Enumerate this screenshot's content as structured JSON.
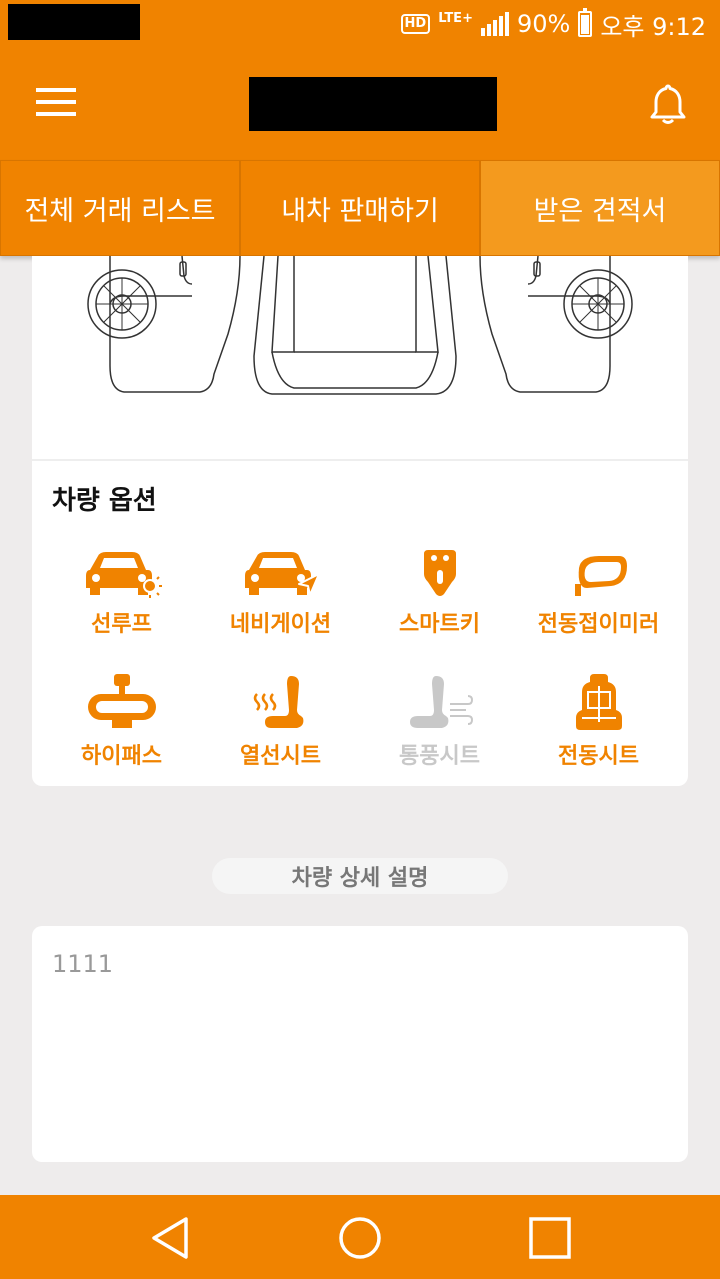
{
  "status_bar": {
    "hd": "HD",
    "network": "LTE+",
    "battery": "90%",
    "time": "오후 9:12"
  },
  "tabs": [
    {
      "label": "전체 거래 리스트"
    },
    {
      "label": "내차 판매하기"
    },
    {
      "label": "받은 견적서"
    }
  ],
  "options": {
    "title": "차량 옵션",
    "items": [
      {
        "label": "선루프",
        "icon": "sunroof-icon",
        "enabled": true
      },
      {
        "label": "네비게이션",
        "icon": "navigation-icon",
        "enabled": true
      },
      {
        "label": "스마트키",
        "icon": "smart-key-icon",
        "enabled": true
      },
      {
        "label": "전동접이미러",
        "icon": "folding-mirror-icon",
        "enabled": true
      },
      {
        "label": "하이패스",
        "icon": "hipass-icon",
        "enabled": true
      },
      {
        "label": "열선시트",
        "icon": "heated-seat-icon",
        "enabled": true
      },
      {
        "label": "통풍시트",
        "icon": "ventilated-seat-icon",
        "enabled": false
      },
      {
        "label": "전동시트",
        "icon": "power-seat-icon",
        "enabled": true
      }
    ]
  },
  "description": {
    "title": "차량 상세 설명",
    "text": "1111"
  },
  "colors": {
    "accent": "#f08300",
    "disabled": "#c8c8c8",
    "background": "#eeecec"
  }
}
